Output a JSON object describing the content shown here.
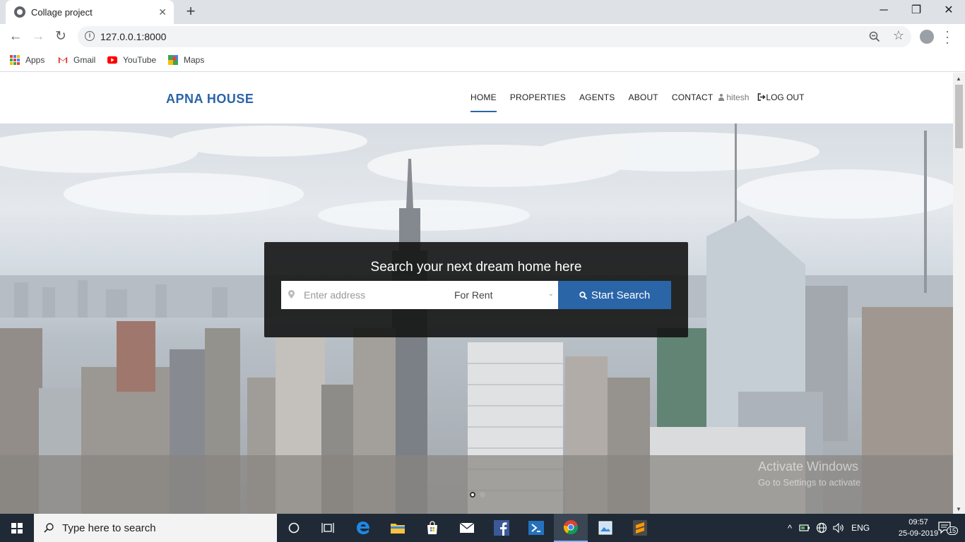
{
  "browser": {
    "tab_title": "Collage project",
    "tab_close": "✕",
    "new_tab": "+",
    "url": "127.0.0.1:8000",
    "bookmarks": [
      {
        "label": "Apps"
      },
      {
        "label": "Gmail"
      },
      {
        "label": "YouTube"
      },
      {
        "label": "Maps"
      }
    ],
    "window_controls": {
      "minimize": "─",
      "restore": "❐",
      "close": "✕"
    }
  },
  "site": {
    "logo": "APNA HOUSE",
    "nav": [
      {
        "label": "HOME",
        "active": true
      },
      {
        "label": "PROPERTIES"
      },
      {
        "label": "AGENTS"
      },
      {
        "label": "ABOUT"
      },
      {
        "label": "CONTACT"
      }
    ],
    "user_name": "hitesh",
    "logout_label": "LOG OUT"
  },
  "hero": {
    "search_title": "Search your next dream home here",
    "address_placeholder": "Enter address",
    "type_selected": "For Rent",
    "search_button": "Start Search",
    "slides": 2,
    "active_slide": 1,
    "watermark_line1": "Activate Windows",
    "watermark_line2": "Go to Settings to activate"
  },
  "taskbar": {
    "search_placeholder": "Type here to search",
    "language": "ENG",
    "time": "09:57",
    "date": "25-09-2019",
    "notification_count": "15"
  },
  "colors": {
    "brand": "#2a65a8",
    "taskbar": "#1f2a36"
  }
}
